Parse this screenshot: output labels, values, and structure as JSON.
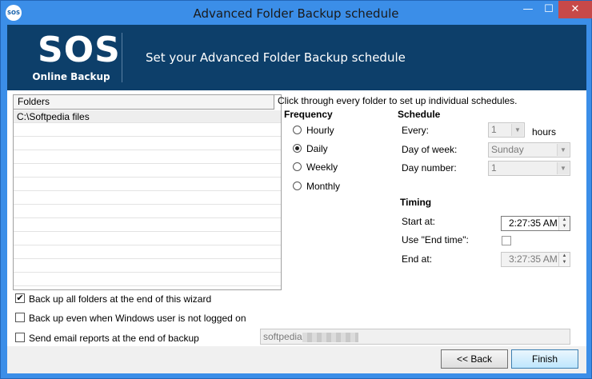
{
  "window": {
    "title": "Advanced Folder Backup schedule",
    "icon_label": "SOS",
    "minimize_glyph": "—",
    "maximize_glyph": "☐",
    "close_glyph": "✕"
  },
  "banner": {
    "logo_big": "SOS",
    "logo_small": "Online Backup",
    "heading": "Set your Advanced Folder Backup schedule"
  },
  "folders": {
    "header": "Folders",
    "rows": [
      "C:\\Softpedia files"
    ]
  },
  "instructions": "Click through every folder to set up individual schedules.",
  "frequency": {
    "title": "Frequency",
    "options": [
      "Hourly",
      "Daily",
      "Weekly",
      "Monthly"
    ],
    "selected": "Daily"
  },
  "schedule": {
    "title": "Schedule",
    "every_label": "Every:",
    "every_value": "1",
    "every_unit": "hours",
    "day_of_week_label": "Day of week:",
    "day_of_week_value": "Sunday",
    "day_number_label": "Day number:",
    "day_number_value": "1"
  },
  "timing": {
    "title": "Timing",
    "start_label": "Start at:",
    "start_value": "2:27:35 AM",
    "use_end_label": "Use \"End time\":",
    "use_end_checked": false,
    "end_label": "End at:",
    "end_value": "3:27:35 AM"
  },
  "options": {
    "backup_all_label": "Back up all folders at the end of this wizard",
    "backup_all_checked": true,
    "backup_logged_off_label": "Back up even when Windows user is not logged on",
    "backup_logged_off_checked": false,
    "email_reports_label": "Send email reports at the end of backup",
    "email_reports_checked": false,
    "email_value": "softpedia"
  },
  "buttons": {
    "back": "<< Back",
    "finish": "Finish"
  },
  "icons": {
    "dropdown": "▼",
    "spin_up": "▲",
    "spin_down": "▼",
    "check": "✔"
  },
  "colors": {
    "title_bar": "#3b8ee8",
    "banner": "#0d3f6a",
    "close_button": "#c74949"
  }
}
